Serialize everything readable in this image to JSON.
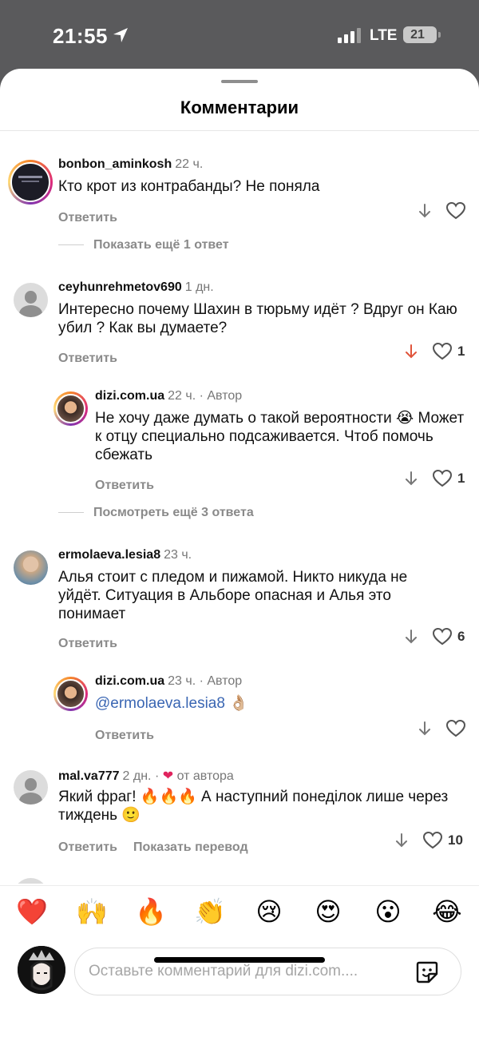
{
  "status_bar": {
    "time": "21:55",
    "network": "LTE",
    "battery": "21"
  },
  "sheet": {
    "title": "Комментарии"
  },
  "comments": [
    {
      "username": "bonbon_aminkosh",
      "time": "22 ч.",
      "text": "Кто крот из контрабанды? Не поняла",
      "reply_label": "Ответить",
      "likes": "",
      "more_replies": "Показать ещё 1 ответ"
    },
    {
      "username": "ceyhunrehmetov690",
      "time": "1 дн.",
      "text": "Интересно почему Шахин в тюрьму идёт ? Вдруг он Каю убил ? Как вы думаете?",
      "reply_label": "Ответить",
      "likes": "1",
      "replies": [
        {
          "username": "dizi.com.ua",
          "time": "22 ч.",
          "badge": "· Автор",
          "text": "Не хочу даже думать о такой вероятности 😭 Может к отцу специально подсаживается. Чтоб помочь сбежать",
          "reply_label": "Ответить",
          "likes": "1"
        }
      ],
      "more_replies": "Посмотреть ещё 3 ответа"
    },
    {
      "username": "ermolaeva.lesia8",
      "time": "23 ч.",
      "text": "Алья стоит с пледом и пижамой. Никто никуда не уйдёт. Ситуация в Альборе опасная и Алья это понимает",
      "reply_label": "Ответить",
      "likes": "6",
      "replies": [
        {
          "username": "dizi.com.ua",
          "time": "23 ч.",
          "badge": "· Автор",
          "mention": "@ermolaeva.lesia8",
          "text": " 👌🏼",
          "reply_label": "Ответить",
          "likes": ""
        }
      ]
    },
    {
      "username": "mal.va777",
      "time": "2 дн.",
      "badge_sep": "·",
      "badge_text": "от автора",
      "text": "Який фраг! 🔥🔥🔥 А наступний понеділок лише через тиждень 🙂",
      "reply_label": "Ответить",
      "translate_label": "Показать перевод",
      "likes": "10"
    }
  ],
  "emoji_bar": [
    "❤️",
    "🙌",
    "🔥",
    "👏",
    "😢",
    "😍",
    "😮",
    "😂"
  ],
  "composer": {
    "placeholder": "Оставьте комментарий для dizi.com...."
  },
  "colors": {
    "like_arrow_active": "#e0543b",
    "mention": "#3a66b3",
    "heart_badge": "#e0245e"
  }
}
